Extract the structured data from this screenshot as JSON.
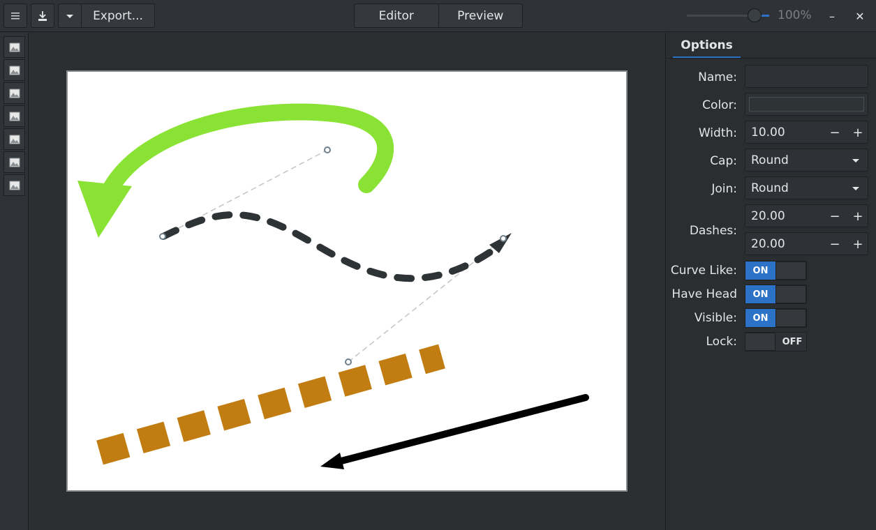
{
  "titlebar": {
    "menu_icon": "hamburger-icon",
    "save_icon": "download-icon",
    "dropdown_icon": "chevron-down-icon",
    "export_label": "Export...",
    "tabs": [
      {
        "label": "Editor"
      },
      {
        "label": "Preview"
      }
    ],
    "zoom_percent": 100,
    "zoom_label": "100%",
    "minimize_label": "–",
    "close_label": "✕"
  },
  "toolbox": {
    "tools": [
      {
        "icon": "image-icon"
      },
      {
        "icon": "image-icon"
      },
      {
        "icon": "image-icon"
      },
      {
        "icon": "image-icon"
      },
      {
        "icon": "image-icon"
      },
      {
        "icon": "image-icon"
      },
      {
        "icon": "image-icon"
      }
    ]
  },
  "colors": {
    "green_arrow": "#8ae234",
    "dashed_curve": "#2e3436",
    "orange_dashes": "#c17d11",
    "black_arrow": "#000000",
    "accent": "#2c73c7"
  },
  "options": {
    "tab_label": "Options",
    "name_label": "Name:",
    "name_value": "",
    "color_label": "Color:",
    "width_label": "Width:",
    "width_value": "10.00",
    "cap_label": "Cap:",
    "cap_value": "Round",
    "join_label": "Join:",
    "join_value": "Round",
    "dashes_label": "Dashes:",
    "dash_1": "20.00",
    "dash_2": "20.00",
    "minus": "−",
    "plus": "+",
    "curve_like_label": "Curve Like:",
    "curve_like_state": "ON",
    "have_head_label": "Have Head",
    "have_head_state": "ON",
    "visible_label": "Visible:",
    "visible_state": "ON",
    "lock_label": "Lock:",
    "lock_state": "OFF"
  }
}
